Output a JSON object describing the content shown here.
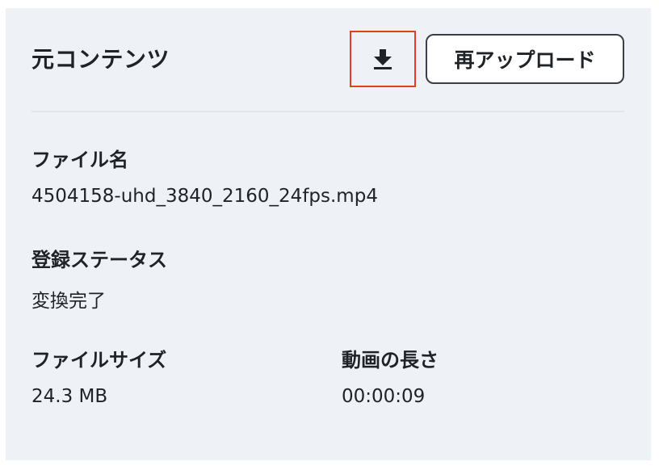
{
  "header": {
    "title": "元コンテンツ",
    "download_icon": "download-icon",
    "reupload_label": "再アップロード"
  },
  "details": {
    "file_name": {
      "label": "ファイル名",
      "value": "4504158-uhd_3840_2160_24fps.mp4"
    },
    "registration_status": {
      "label": "登録ステータス",
      "value": "変換完了"
    },
    "file_size": {
      "label": "ファイルサイズ",
      "value": "24.3 MB"
    },
    "duration": {
      "label": "動画の長さ",
      "value": "00:00:09"
    }
  },
  "colors": {
    "panel_background": "#eef1f6",
    "highlight_border": "#e2401c",
    "text": "#1f2328",
    "button_border": "#3a3f47"
  }
}
